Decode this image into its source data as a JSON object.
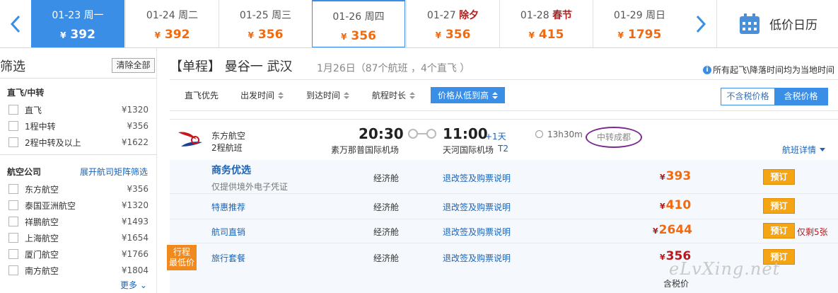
{
  "datebar": {
    "days": [
      {
        "date": "01-23",
        "weekday": "周一",
        "holiday": "",
        "price": "392"
      },
      {
        "date": "01-24",
        "weekday": "周二",
        "holiday": "",
        "price": "392"
      },
      {
        "date": "01-25",
        "weekday": "周三",
        "holiday": "",
        "price": "356"
      },
      {
        "date": "01-26",
        "weekday": "周四",
        "holiday": "",
        "price": "356"
      },
      {
        "date": "01-27",
        "weekday": "",
        "holiday": "除夕",
        "price": "356"
      },
      {
        "date": "01-28",
        "weekday": "",
        "holiday": "春节",
        "price": "415"
      },
      {
        "date": "01-29",
        "weekday": "周日",
        "holiday": "",
        "price": "1795"
      }
    ],
    "currency": "¥",
    "calendar_label": "低价日历"
  },
  "filter": {
    "heading": "筛选",
    "clear_label": "清除全部",
    "stops_title": "直飞/中转",
    "stops": [
      {
        "label": "直飞",
        "price": "¥1320"
      },
      {
        "label": "1程中转",
        "price": "¥356"
      },
      {
        "label": "2程中转及以上",
        "price": "¥1622"
      }
    ],
    "airline_title": "航空公司",
    "matrix_link": "展开航司矩阵筛选",
    "airlines": [
      {
        "label": "东方航空",
        "price": "¥356"
      },
      {
        "label": "泰国亚洲航空",
        "price": "¥1320"
      },
      {
        "label": "祥鹏航空",
        "price": "¥1493"
      },
      {
        "label": "上海航空",
        "price": "¥1654"
      },
      {
        "label": "厦门航空",
        "price": "¥1766"
      },
      {
        "label": "南方航空",
        "price": "¥1804"
      }
    ],
    "more_label": "更多"
  },
  "route": {
    "title": "【单程】 曼谷一 武汉",
    "sub": "1月26日（87个航班 ，4个直飞 ）",
    "tz_note": "所有起飞\\降落时间均为当地时间"
  },
  "sortbar": {
    "items": [
      "直飞优先",
      "出发时间",
      "到达时间",
      "航程时长",
      "价格从低到高"
    ],
    "tax_off": "不含税价格",
    "tax_on": "含税价格"
  },
  "flight": {
    "airline": "东方航空",
    "model": "2程航班",
    "dep_time": "20:30",
    "dep_airport": "素万那普国际机场",
    "arr_time": "11:00",
    "arr_plus": "+1天",
    "arr_airport": "天河国际机场",
    "terminal": "T2",
    "duration": "13h30m",
    "stopover": "中转成都",
    "details_label": "航班详情"
  },
  "fares": [
    {
      "name": "商务优选",
      "sub": "仅提供境外电子凭证",
      "cabin": "经济舱",
      "rules": "退改签及购票说明",
      "price": "393",
      "book": "预订",
      "remain": ""
    },
    {
      "name": "特惠推荐",
      "sub": "",
      "cabin": "经济舱",
      "rules": "退改签及购票说明",
      "price": "410",
      "book": "预订",
      "remain": ""
    },
    {
      "name": "航司直销",
      "sub": "",
      "cabin": "经济舱",
      "rules": "退改签及购票说明",
      "price": "2644",
      "book": "预订",
      "remain": "仅剩5张"
    },
    {
      "name": "旅行套餐",
      "sub": "",
      "cabin": "经济舱",
      "rules": "退改签及购票说明",
      "price": "356",
      "book": "预订",
      "remain": ""
    }
  ],
  "badge_line1": "行程",
  "badge_line2": "最低价",
  "tax_included": "含税价",
  "watermark": "eLvXing.net",
  "colors": {
    "accent": "#3a8ee6",
    "price": "#f06a0f",
    "book": "#f5a413",
    "holiday": "#b21e1e"
  }
}
